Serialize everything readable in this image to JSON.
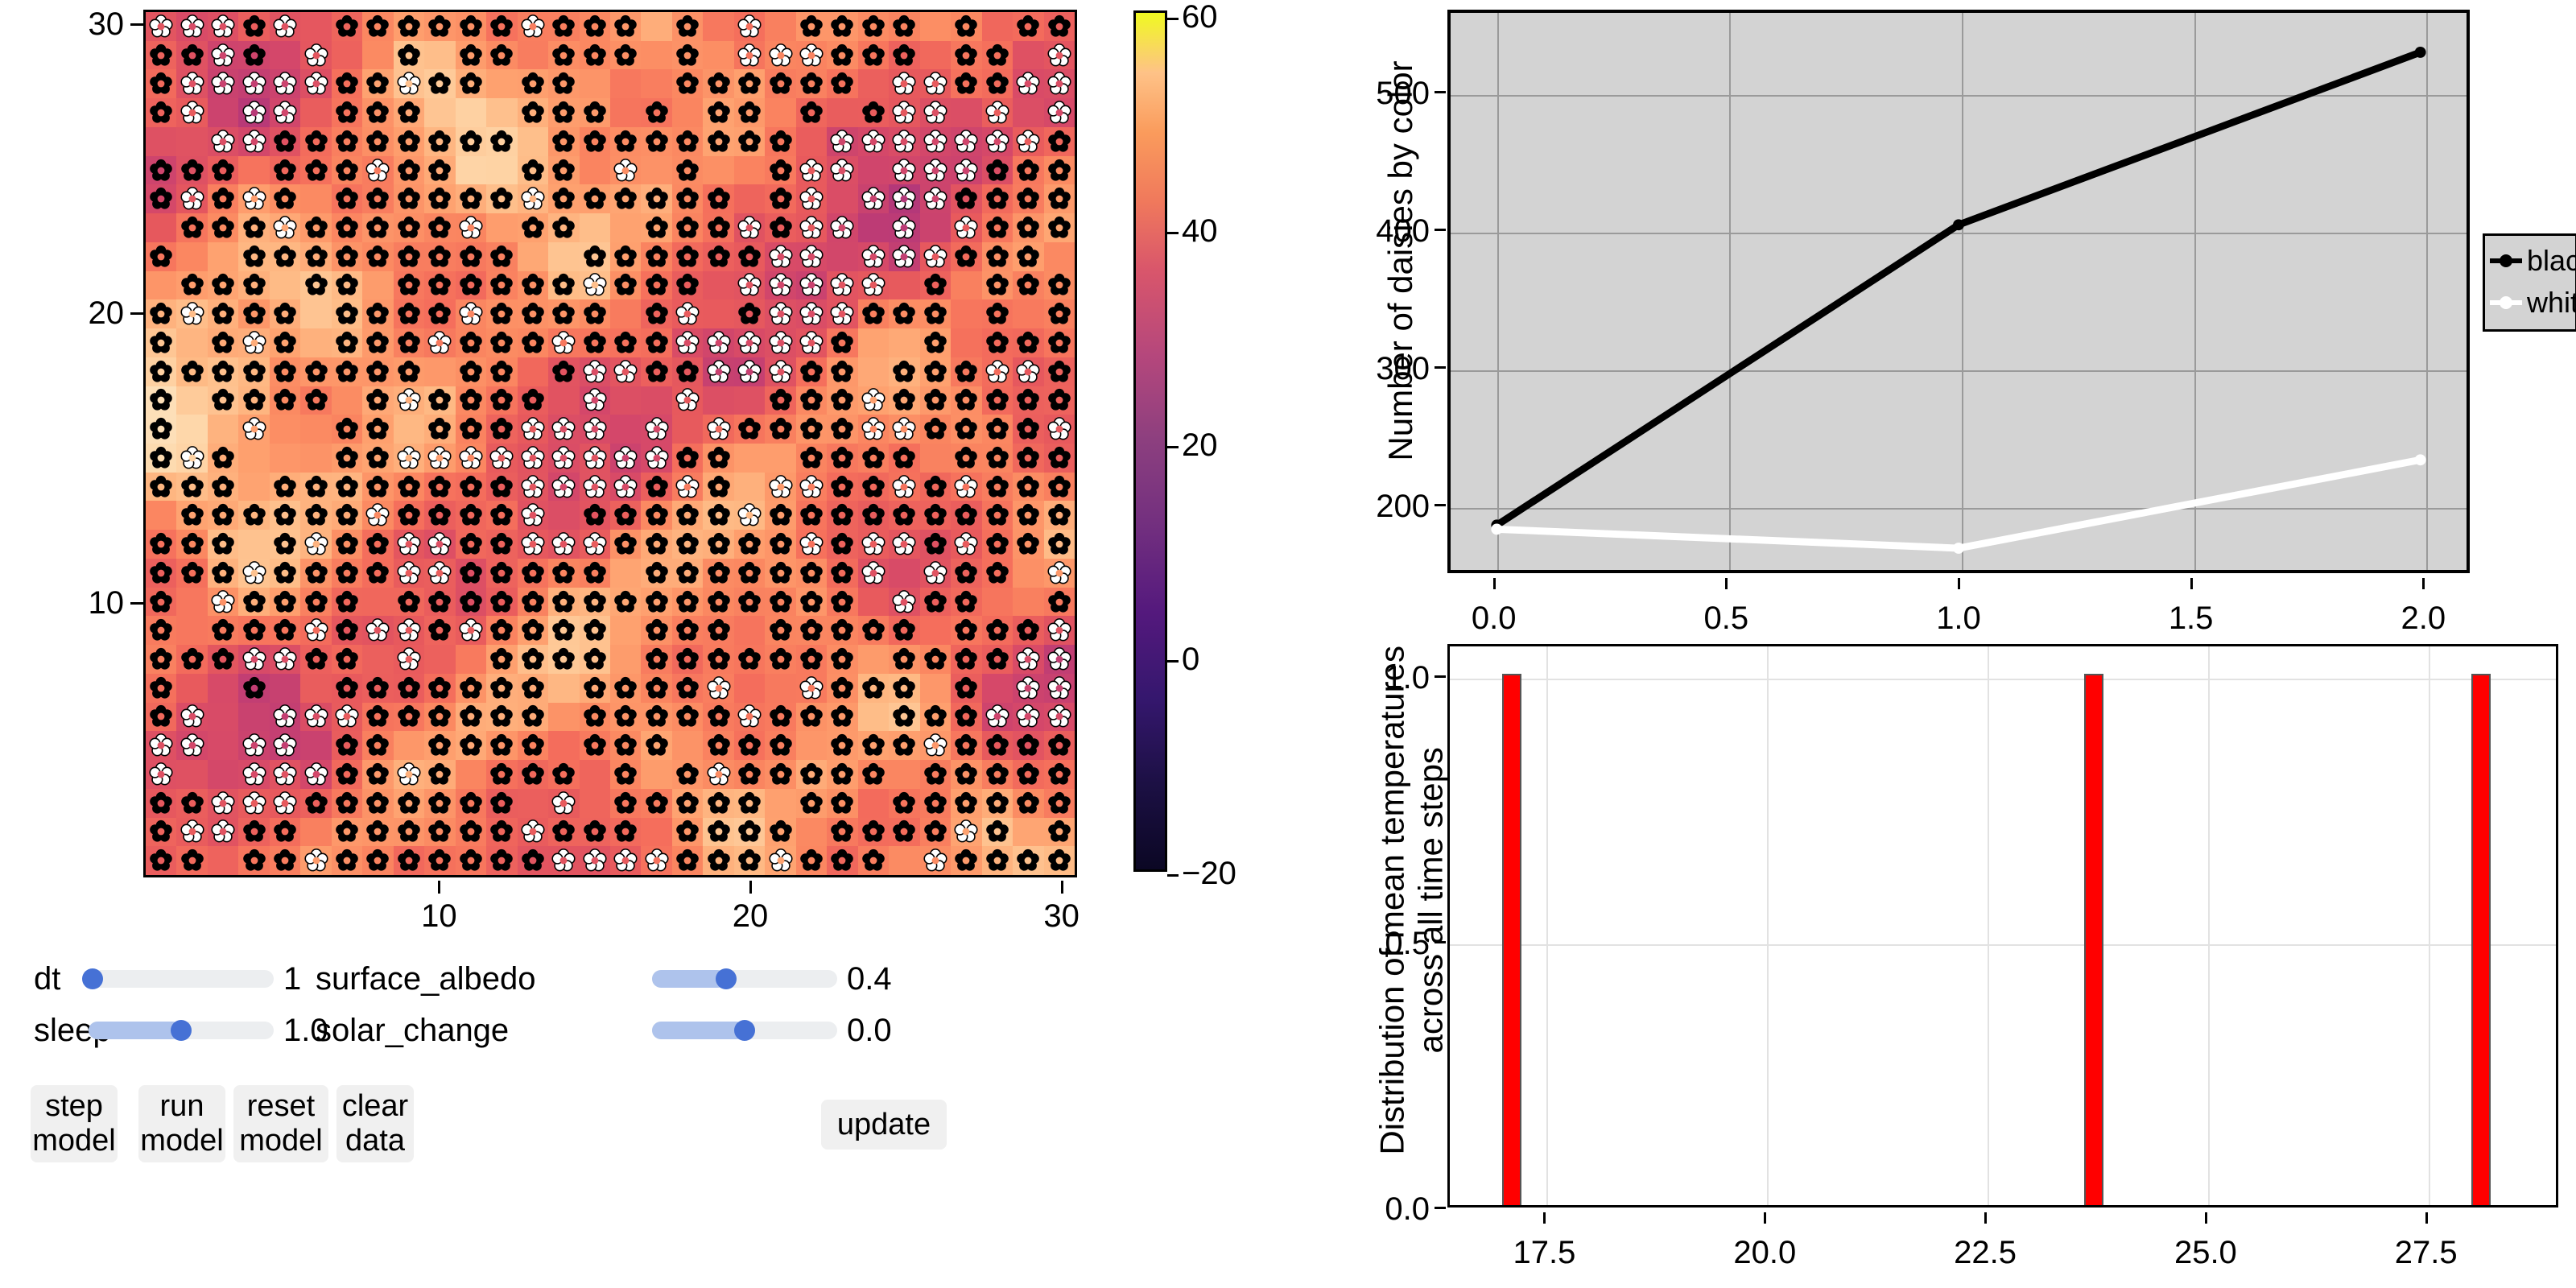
{
  "grid": {
    "xticks": [
      "10",
      "20",
      "30"
    ],
    "yticks": [
      "10",
      "20",
      "30"
    ],
    "x_positions": [
      10,
      20,
      30
    ],
    "y_positions": [
      10,
      20,
      30
    ],
    "size": 30
  },
  "colorbar": {
    "ticks": [
      "60",
      "40",
      "20",
      "0",
      "−20"
    ],
    "values": [
      60,
      40,
      20,
      0,
      -20
    ],
    "vmin": -20,
    "vmax": 60,
    "colormap": "magma"
  },
  "controls": {
    "sliders": [
      {
        "label": "dt",
        "value": "1",
        "fraction": 0.02
      },
      {
        "label": "sleep",
        "value": "1.0",
        "fraction": 0.5
      },
      {
        "label": "surface_albedo",
        "value": "0.4",
        "fraction": 0.4
      },
      {
        "label": "solar_change",
        "value": "0.0",
        "fraction": 0.5
      }
    ],
    "buttons": [
      {
        "label": "step\nmodel",
        "name": "step-model-button"
      },
      {
        "label": "run\nmodel",
        "name": "run-model-button"
      },
      {
        "label": "reset\nmodel",
        "name": "reset-model-button"
      },
      {
        "label": "clear\ndata",
        "name": "clear-data-button"
      },
      {
        "label": "update",
        "name": "update-button"
      }
    ]
  },
  "chart_data": [
    {
      "type": "line",
      "title": "",
      "ylabel": "Number of daisies by color",
      "xlabel": "",
      "x": [
        0.0,
        1.0,
        2.0
      ],
      "xticks": [
        "0.0",
        "0.5",
        "1.0",
        "1.5",
        "2.0"
      ],
      "xtick_values": [
        0.0,
        0.5,
        1.0,
        1.5,
        2.0
      ],
      "yticks": [
        "200",
        "300",
        "400",
        "500"
      ],
      "ytick_values": [
        200,
        300,
        400,
        500
      ],
      "xlim": [
        -0.1,
        2.1
      ],
      "ylim": [
        150,
        560
      ],
      "grid": true,
      "legend_position": "right",
      "plot_background": "#d3d3d3",
      "series": [
        {
          "name": "black",
          "color": "#000000",
          "values": [
            183,
            404,
            531
          ]
        },
        {
          "name": "white",
          "color": "#ffffff",
          "values": [
            180,
            166,
            231
          ]
        }
      ]
    },
    {
      "type": "bar",
      "title": "",
      "ylabel": "Distribution of mean temperatures\nacross all time steps",
      "xlabel": "",
      "categories": [
        17.1,
        23.7,
        28.1
      ],
      "values": [
        1.0,
        1.0,
        1.0
      ],
      "xticks": [
        "17.5",
        "20.0",
        "22.5",
        "25.0",
        "27.5"
      ],
      "xtick_values": [
        17.5,
        20.0,
        22.5,
        25.0,
        27.5
      ],
      "yticks": [
        "0.0",
        "0.5",
        "1.0"
      ],
      "ytick_values": [
        0.0,
        0.5,
        1.0
      ],
      "xlim": [
        16.4,
        29.0
      ],
      "ylim": [
        0.0,
        1.06
      ],
      "grid": true,
      "bar_color": "#ff0000",
      "bar_edge_color": "#555555",
      "plot_background": "#ffffff"
    }
  ]
}
